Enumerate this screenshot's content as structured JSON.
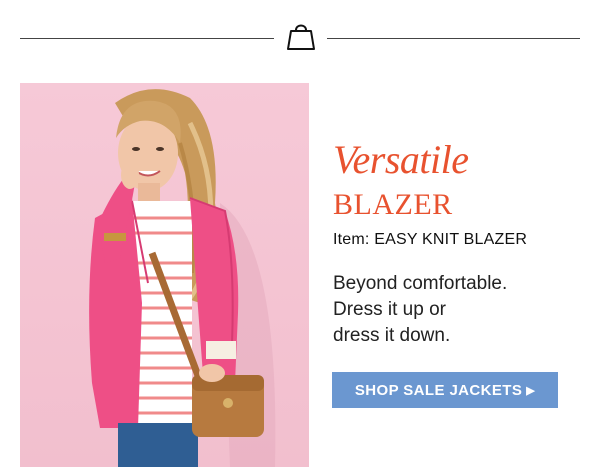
{
  "header": {
    "icon": "shopping-bag-icon"
  },
  "hero": {
    "image_alt": "woman-in-pink-blazer"
  },
  "promo": {
    "headline_script": "Versatile",
    "headline_caps": "BLAZER",
    "item_line": "Item: EASY KNIT BLAZER",
    "body_lines": [
      "Beyond comfortable.",
      "Dress it up or",
      "dress it down."
    ],
    "cta_label": "SHOP SALE JACKETS",
    "cta_arrow": "▶"
  },
  "colors": {
    "accent": "#e8522f",
    "cta": "#6b97d0",
    "photo_bg": "#f3c4d2",
    "blazer": "#ee4f86"
  }
}
